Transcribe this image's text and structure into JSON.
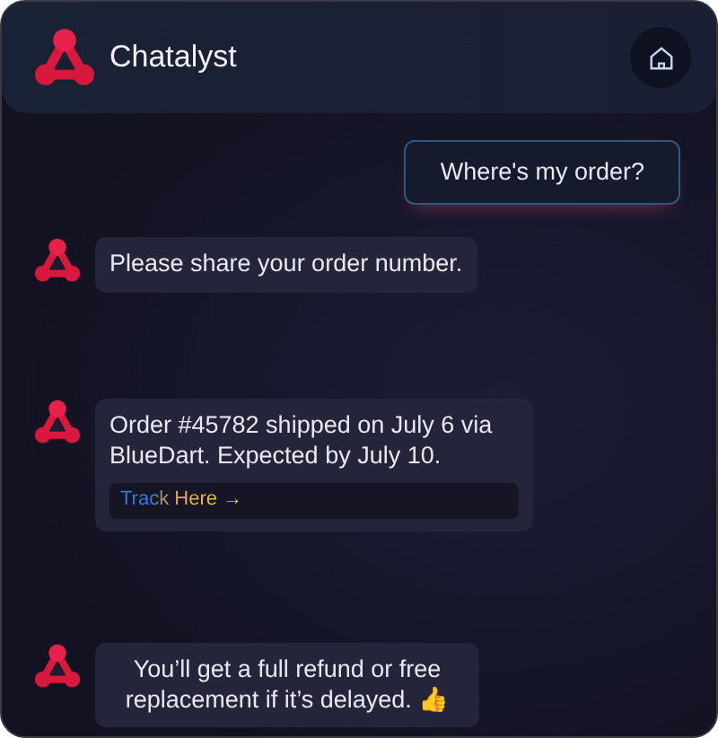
{
  "header": {
    "title": "Chatalyst"
  },
  "messages": [
    {
      "kind": "user",
      "text": "Where's my order?"
    },
    {
      "kind": "bot",
      "text": "Please share your order number."
    },
    {
      "kind": "bot",
      "text": "Order #45782 shipped on July 6 via BlueDart. Expected by July 10.",
      "link": "Track Here →"
    },
    {
      "kind": "bot",
      "text": "You’ll get a full refund or free replacement if it’s delayed. 👍"
    }
  ]
}
